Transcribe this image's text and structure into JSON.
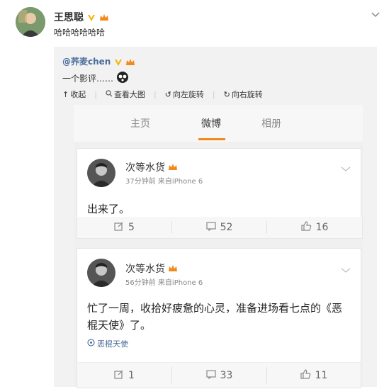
{
  "post": {
    "username": "王思聪",
    "text": "哈哈哈哈哈哈"
  },
  "repost": {
    "username": "@荞麦chen",
    "text": "一个影评……",
    "toolbar": {
      "collapse": "收起",
      "view_large": "查看大图",
      "rotate_left": "向左旋转",
      "rotate_right": "向右旋转"
    }
  },
  "tabs": [
    "主页",
    "微博",
    "相册"
  ],
  "active_tab": "微博",
  "feed": [
    {
      "username": "次等水货",
      "time": "37分钟前",
      "source": "来自iPhone 6",
      "text": "出来了。",
      "topic": "",
      "repost_count": "5",
      "comment_count": "52",
      "like_count": "16"
    },
    {
      "username": "次等水货",
      "time": "56分钟前",
      "source": "来自iPhone 6",
      "text": "忙了一周，收拾好疲惫的心灵，准备进场看七点的《恶棍天使》了。",
      "topic": "恶棍天使",
      "repost_count": "1",
      "comment_count": "33",
      "like_count": "11"
    }
  ],
  "colors": {
    "accent_orange": "#f28a1a",
    "badge_yellow": "#f5b400",
    "link_blue": "#4a6c9b",
    "panel_gray": "#f2f2f2"
  }
}
